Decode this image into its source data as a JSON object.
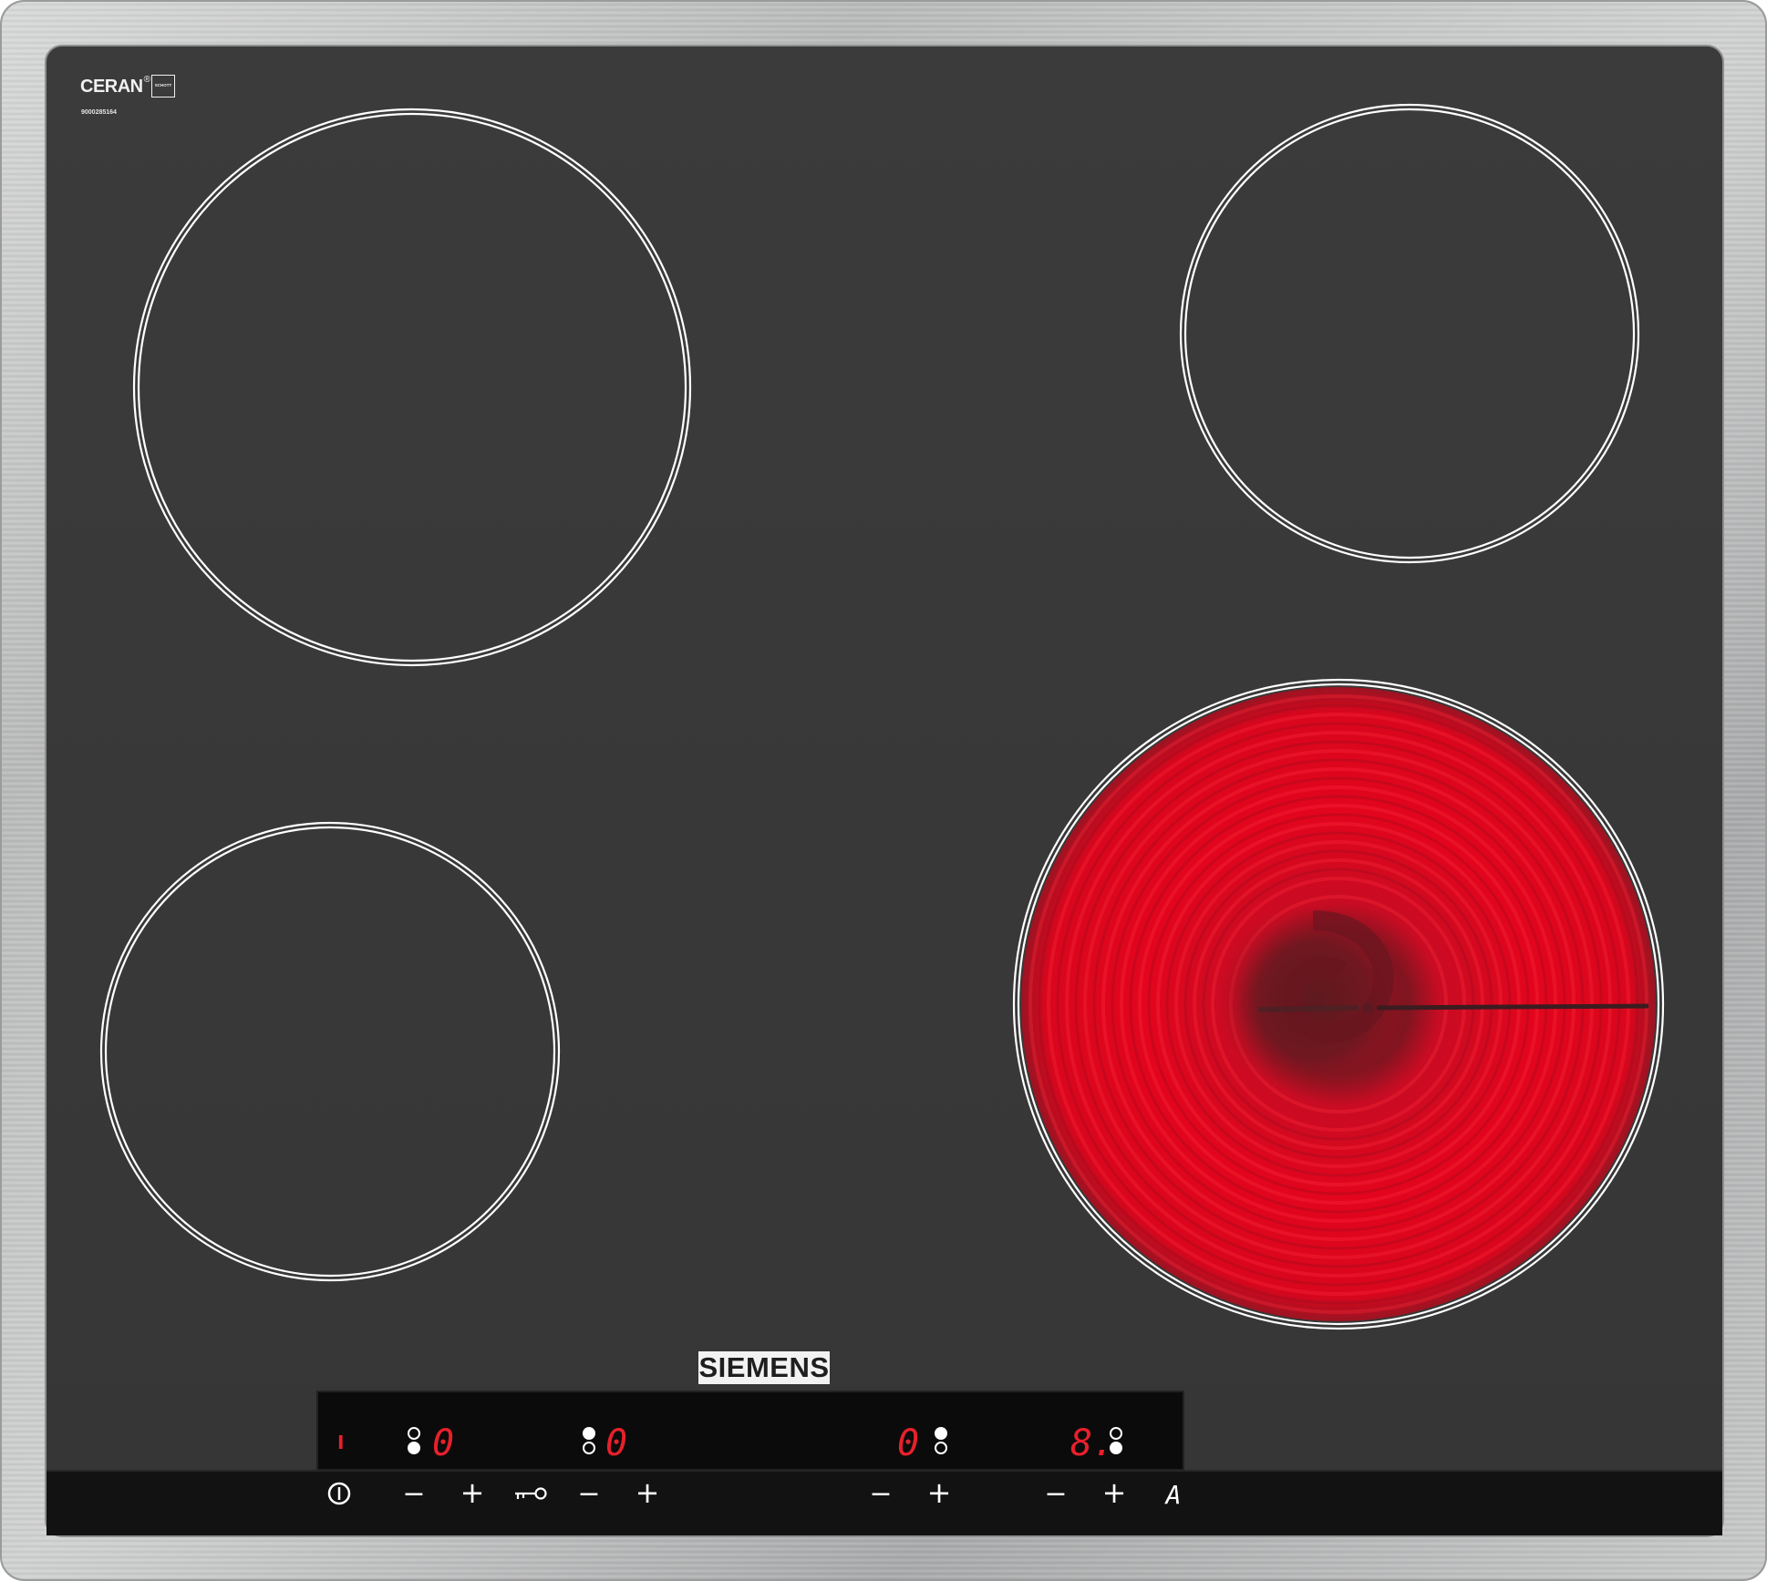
{
  "brand": {
    "name": "SIEMENS",
    "glass_logo": "CERAN",
    "glass_logo_mark": "®",
    "glass_maker": "SCHOTT",
    "serial_number": "9000285164"
  },
  "colors": {
    "frame_steel": "#c6c7c7",
    "glass": "#3a3a3a",
    "control_strip": "#121212",
    "display_panel": "#0c0c0c",
    "zone_outline": "#ffffff",
    "heating_red": "#e3001b",
    "display_digit": "#e8202c",
    "control_symbol": "#ffffff"
  },
  "cooking_zones": [
    {
      "id": "rear-left",
      "state": "off"
    },
    {
      "id": "rear-right",
      "state": "off"
    },
    {
      "id": "front-left",
      "state": "off"
    },
    {
      "id": "front-right",
      "state": "glowing"
    }
  ],
  "displays": {
    "main_switch_indicator": "I",
    "zone_1_level": "0",
    "zone_2_level": "0",
    "zone_3_level": "0",
    "zone_4_level": "8."
  },
  "controls": {
    "power_icon": "power-symbol-icon",
    "lock_icon": "key-icon",
    "minus_label": "−",
    "plus_label": "+",
    "auto_boost_label": "A"
  }
}
